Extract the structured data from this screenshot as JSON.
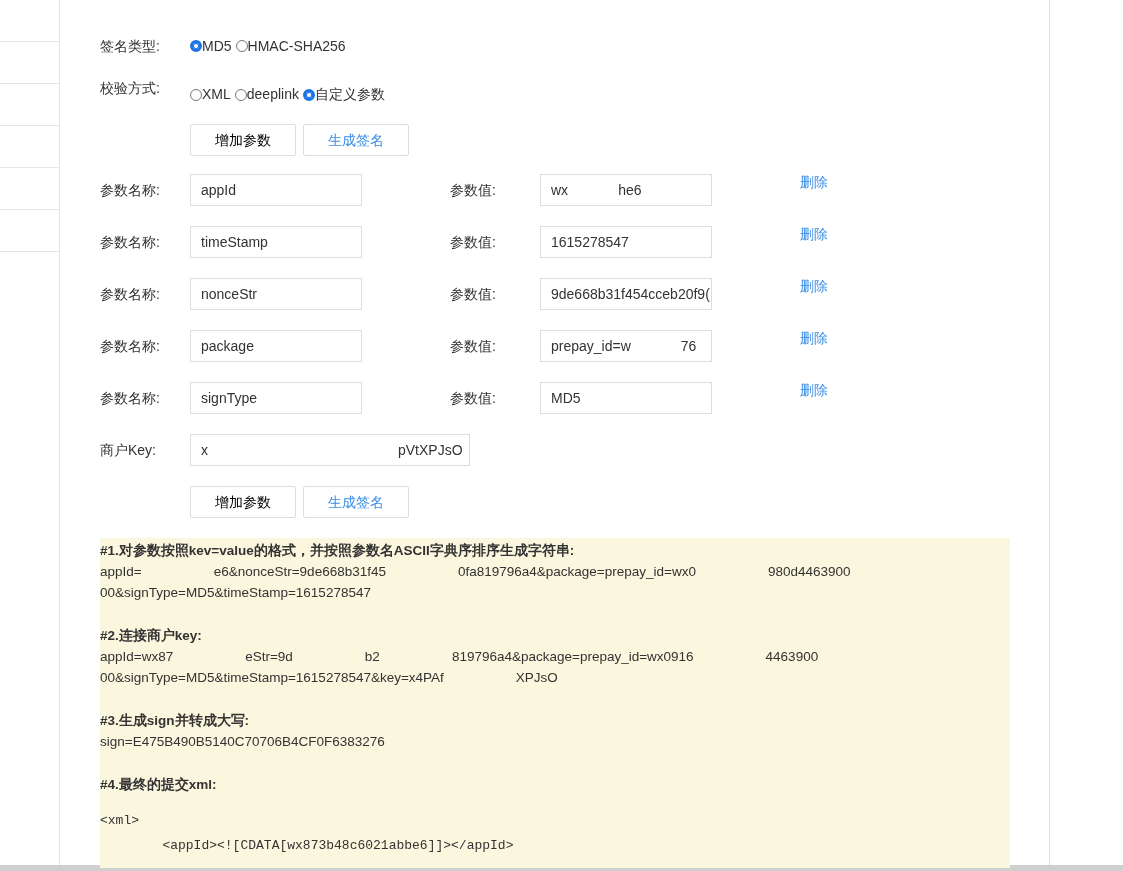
{
  "sign_type": {
    "label": "签名类型:",
    "options": [
      {
        "label": "MD5",
        "selected": true
      },
      {
        "label": "HMAC-SHA256",
        "selected": false
      }
    ]
  },
  "verify_mode": {
    "label": "校验方式:",
    "options": [
      {
        "label": "XML",
        "selected": false
      },
      {
        "label": "deeplink",
        "selected": false
      },
      {
        "label": "自定义参数",
        "selected": true
      }
    ]
  },
  "buttons": [
    {
      "label": "增加参数",
      "kind": "plain"
    },
    {
      "label": "生成签名",
      "kind": "link"
    }
  ],
  "params": [
    {
      "name_label": "参数名称:",
      "name": "appId",
      "value_label": "参数值:",
      "value": [
        "wx",
        "he6"
      ],
      "delete": "删除"
    },
    {
      "name_label": "参数名称:",
      "name": "timeStamp",
      "value_label": "参数值:",
      "value": [
        "1615278547"
      ],
      "delete": "删除"
    },
    {
      "name_label": "参数名称:",
      "name": "nonceStr",
      "value_label": "参数值:",
      "value": [
        "9de668b31f454cceb20f9("
      ],
      "delete": "删除"
    },
    {
      "name_label": "参数名称:",
      "name": "package",
      "value_label": "参数值:",
      "value": [
        "prepay_id=w",
        "76"
      ],
      "delete": "删除"
    },
    {
      "name_label": "参数名称:",
      "name": "signType",
      "value_label": "参数值:",
      "value": [
        "MD5"
      ],
      "delete": "删除"
    }
  ],
  "merchant_key": {
    "label": "商户Key:",
    "value": [
      "x",
      "pVtXPJsO"
    ]
  },
  "buttons_bottom": [
    {
      "label": "增加参数",
      "kind": "plain"
    },
    {
      "label": "生成签名",
      "kind": "link"
    }
  ],
  "result": {
    "steps": [
      {
        "heading": "#1.对参数按照kev=value的格式，并按照参数名ASCII字典序排序生成字符串:",
        "lines": [
          [
            "appId=",
            "e6&nonceStr=9de668b31f45",
            "0fa819796a4&package=prepay_id=wx0",
            "980d4463900"
          ],
          [
            "00&signType=MD5&timeStamp=1615278547"
          ]
        ]
      },
      {
        "heading": "#2.连接商户key:",
        "lines": [
          [
            "appId=wx87",
            "eStr=9d",
            "b2",
            "819796a4&package=prepay_id=wx0916",
            "4463900"
          ],
          [
            "00&signType=MD5&timeStamp=1615278547&key=x4PAf",
            "XPJsO"
          ]
        ]
      },
      {
        "heading": "#3.生成sign并转成大写:",
        "lines": [
          [
            "sign=E475B490B5140C70706B4CF0F6383276"
          ]
        ]
      },
      {
        "heading": "#4.最终的提交xml:"
      }
    ],
    "xml_lines": [
      "<xml>",
      "        <appId><![CDATA[wx873b48c6021abbe6]]></appId>"
    ]
  }
}
